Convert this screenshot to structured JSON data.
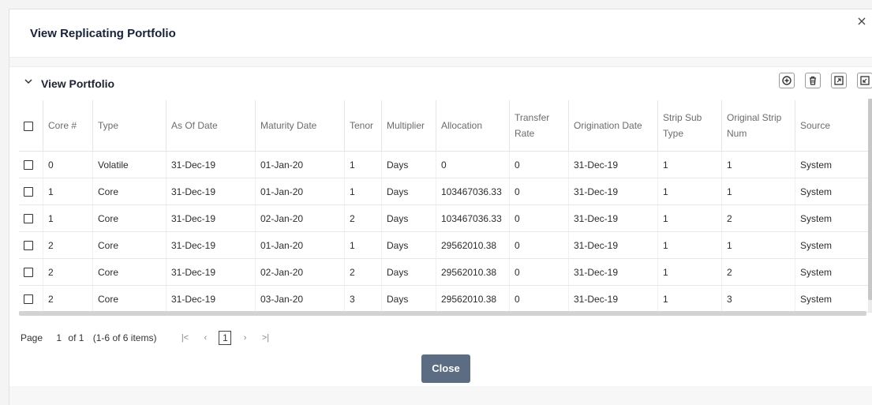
{
  "dialog": {
    "title": "View Replicating Portfolio",
    "close_glyph": "×"
  },
  "section": {
    "title": "View Portfolio",
    "collapse_glyph": "⌄",
    "tools": [
      "add-icon",
      "delete-icon",
      "expand-icon",
      "export-icon"
    ]
  },
  "table": {
    "columns": [
      {
        "label": "",
        "key": "select"
      },
      {
        "label": "Core #",
        "key": "core"
      },
      {
        "label": "Type",
        "key": "type"
      },
      {
        "label": "As Of Date",
        "key": "as_of_date"
      },
      {
        "label": "Maturity Date",
        "key": "maturity_date"
      },
      {
        "label": "Tenor",
        "key": "tenor"
      },
      {
        "label": "Multiplier",
        "key": "multiplier"
      },
      {
        "label": "Allocation",
        "key": "allocation"
      },
      {
        "label": "Transfer Rate",
        "key": "transfer_rate"
      },
      {
        "label": "Origination Date",
        "key": "origination_date"
      },
      {
        "label": "Strip Sub Type",
        "key": "strip_sub_type"
      },
      {
        "label": "Original Strip Num",
        "key": "original_strip_num"
      },
      {
        "label": "Source",
        "key": "source"
      }
    ],
    "rows": [
      {
        "core": "0",
        "type": "Volatile",
        "as_of_date": "31-Dec-19",
        "maturity_date": "01-Jan-20",
        "tenor": "1",
        "multiplier": "Days",
        "allocation": "0",
        "transfer_rate": "0",
        "origination_date": "31-Dec-19",
        "strip_sub_type": "1",
        "original_strip_num": "1",
        "source": "System"
      },
      {
        "core": "1",
        "type": "Core",
        "as_of_date": "31-Dec-19",
        "maturity_date": "01-Jan-20",
        "tenor": "1",
        "multiplier": "Days",
        "allocation": "103467036.33",
        "transfer_rate": "0",
        "origination_date": "31-Dec-19",
        "strip_sub_type": "1",
        "original_strip_num": "1",
        "source": "System"
      },
      {
        "core": "1",
        "type": "Core",
        "as_of_date": "31-Dec-19",
        "maturity_date": "02-Jan-20",
        "tenor": "2",
        "multiplier": "Days",
        "allocation": "103467036.33",
        "transfer_rate": "0",
        "origination_date": "31-Dec-19",
        "strip_sub_type": "1",
        "original_strip_num": "2",
        "source": "System"
      },
      {
        "core": "2",
        "type": "Core",
        "as_of_date": "31-Dec-19",
        "maturity_date": "01-Jan-20",
        "tenor": "1",
        "multiplier": "Days",
        "allocation": "29562010.38",
        "transfer_rate": "0",
        "origination_date": "31-Dec-19",
        "strip_sub_type": "1",
        "original_strip_num": "1",
        "source": "System"
      },
      {
        "core": "2",
        "type": "Core",
        "as_of_date": "31-Dec-19",
        "maturity_date": "02-Jan-20",
        "tenor": "2",
        "multiplier": "Days",
        "allocation": "29562010.38",
        "transfer_rate": "0",
        "origination_date": "31-Dec-19",
        "strip_sub_type": "1",
        "original_strip_num": "2",
        "source": "System"
      },
      {
        "core": "2",
        "type": "Core",
        "as_of_date": "31-Dec-19",
        "maturity_date": "03-Jan-20",
        "tenor": "3",
        "multiplier": "Days",
        "allocation": "29562010.38",
        "transfer_rate": "0",
        "origination_date": "31-Dec-19",
        "strip_sub_type": "1",
        "original_strip_num": "3",
        "source": "System"
      }
    ]
  },
  "pager": {
    "page_label": "Page",
    "page_number": "1",
    "of_label": "of 1",
    "items_summary": "(1-6 of 6 items)",
    "first_glyph": "|<",
    "prev_glyph": "‹",
    "current_page": "1",
    "next_glyph": "›",
    "last_glyph": ">|"
  },
  "footer": {
    "close_label": "Close"
  }
}
